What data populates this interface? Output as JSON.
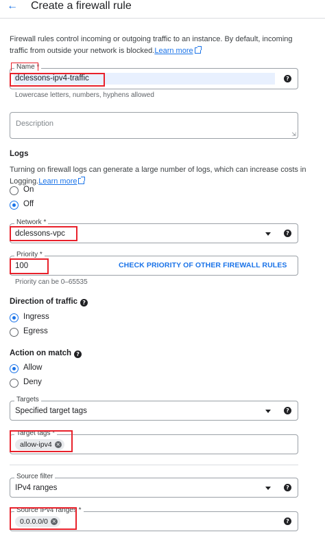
{
  "header": {
    "title": "Create a firewall rule"
  },
  "intro": {
    "text": "Firewall rules control incoming or outgoing traffic to an instance. By default, incoming traffic from outside your network is blocked.",
    "link": "Learn more"
  },
  "name_field": {
    "label": "Name *",
    "value": "dclessons-ipv4-traffic",
    "hint": "Lowercase letters, numbers, hyphens allowed"
  },
  "description_field": {
    "placeholder": "Description"
  },
  "logs": {
    "title": "Logs",
    "text": "Turning on firewall logs can generate a large number of logs, which can increase costs in Logging.",
    "link": "Learn more",
    "options": [
      "On",
      "Off"
    ],
    "selected": "Off"
  },
  "network_field": {
    "label": "Network *",
    "value": "dclessons-vpc"
  },
  "priority_field": {
    "label": "Priority *",
    "value": "100",
    "link": "CHECK PRIORITY OF OTHER FIREWALL RULES",
    "hint": "Priority can be 0–65535"
  },
  "direction": {
    "title": "Direction of traffic",
    "options": [
      "Ingress",
      "Egress"
    ],
    "selected": "Ingress"
  },
  "action": {
    "title": "Action on match",
    "options": [
      "Allow",
      "Deny"
    ],
    "selected": "Allow"
  },
  "targets_field": {
    "label": "Targets",
    "value": "Specified target tags"
  },
  "target_tags_field": {
    "label": "Target tags *",
    "chip": "allow-ipv4"
  },
  "source_filter_field": {
    "label": "Source filter",
    "value": "IPv4 ranges"
  },
  "source_ranges_field": {
    "label": "Source IPv4 ranges *",
    "chip": "0.0.0.0/0"
  },
  "colors": {
    "accent": "#1a73e8",
    "highlight": "#e8202a"
  },
  "icons": {
    "back": "arrow-back-icon",
    "help": "help-icon",
    "dropdown": "dropdown-arrow-icon",
    "chip_remove": "close-circle-icon",
    "external": "external-link-icon"
  }
}
